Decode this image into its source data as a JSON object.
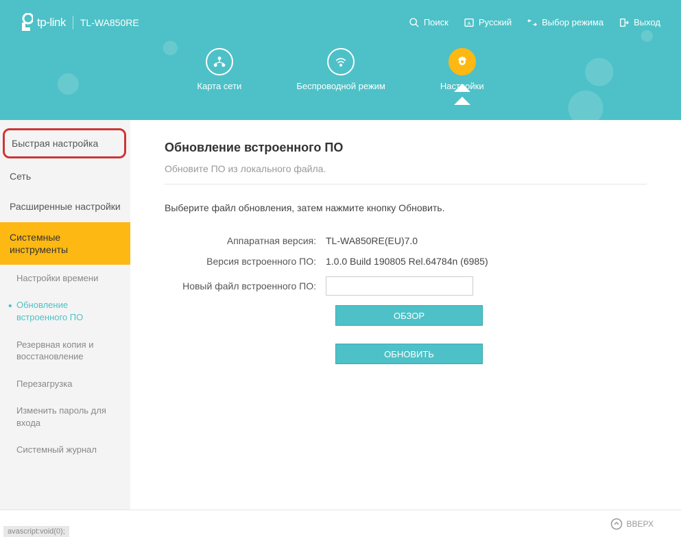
{
  "header": {
    "brand": "tp-link",
    "model": "TL-WA850RE",
    "utils": {
      "search": "Поиск",
      "lang": "Русский",
      "mode": "Выбор режима",
      "logout": "Выход"
    }
  },
  "tabs": {
    "map": "Карта сети",
    "wireless": "Беспроводной режим",
    "settings": "Настройки"
  },
  "sidebar": {
    "quick": "Быстрая настройка",
    "network": "Сеть",
    "advanced": "Расширенные настройки",
    "system": "Системные инструменты",
    "subs": {
      "time": "Настройки времени",
      "fw": "Обновление встроенного ПО",
      "backup": "Резервная копия и восстановление",
      "reboot": "Перезагрузка",
      "password": "Изменить пароль для входа",
      "syslog": "Системный журнал"
    }
  },
  "page": {
    "title": "Обновление встроенного ПО",
    "subtitle": "Обновите ПО из локального файла.",
    "instruction": "Выберите файл обновления, затем нажмите кнопку Обновить.",
    "hw_label": "Аппаратная версия:",
    "hw_value": "TL-WA850RE(EU)7.0",
    "fw_label": "Версия встроенного ПО:",
    "fw_value": "1.0.0 Build 190805 Rel.64784n (6985)",
    "file_label": "Новый файл встроенного ПО:",
    "browse": "ОБЗОР",
    "update": "ОБНОВИТЬ"
  },
  "footer": {
    "top": "ВВЕРХ"
  },
  "status": "avascript:void(0);"
}
